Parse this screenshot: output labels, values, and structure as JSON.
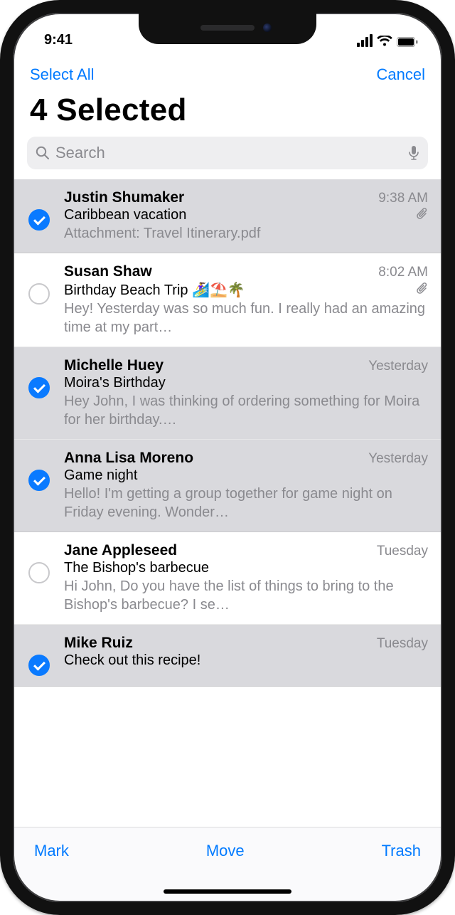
{
  "status": {
    "time": "9:41"
  },
  "nav": {
    "select_all": "Select All",
    "cancel": "Cancel"
  },
  "title": "4 Selected",
  "search": {
    "placeholder": "Search"
  },
  "emails": [
    {
      "selected": true,
      "sender": "Justin Shumaker",
      "time": "9:38 AM",
      "subject": "Caribbean vacation",
      "preview": "Attachment: Travel Itinerary.pdf",
      "attachment": true
    },
    {
      "selected": false,
      "sender": "Susan Shaw",
      "time": "8:02 AM",
      "subject": "Birthday Beach Trip 🏄‍♀️⛱️🌴",
      "preview": "Hey! Yesterday was so much fun. I really had an amazing time at my part…",
      "attachment": true
    },
    {
      "selected": true,
      "sender": "Michelle Huey",
      "time": "Yesterday",
      "subject": "Moira's Birthday",
      "preview": "Hey John, I was thinking of ordering something for Moira for her birthday.…",
      "attachment": false
    },
    {
      "selected": true,
      "sender": "Anna Lisa Moreno",
      "time": "Yesterday",
      "subject": "Game night",
      "preview": "Hello! I'm getting a group together for game night on Friday evening. Wonder…",
      "attachment": false
    },
    {
      "selected": false,
      "sender": "Jane Appleseed",
      "time": "Tuesday",
      "subject": "The Bishop's barbecue",
      "preview": "Hi John, Do you have the list of things to bring to the Bishop's barbecue? I se…",
      "attachment": false
    },
    {
      "selected": true,
      "sender": "Mike Ruiz",
      "time": "Tuesday",
      "subject": "Check out this recipe!",
      "preview": "",
      "attachment": false
    }
  ],
  "toolbar": {
    "mark": "Mark",
    "move": "Move",
    "trash": "Trash"
  }
}
